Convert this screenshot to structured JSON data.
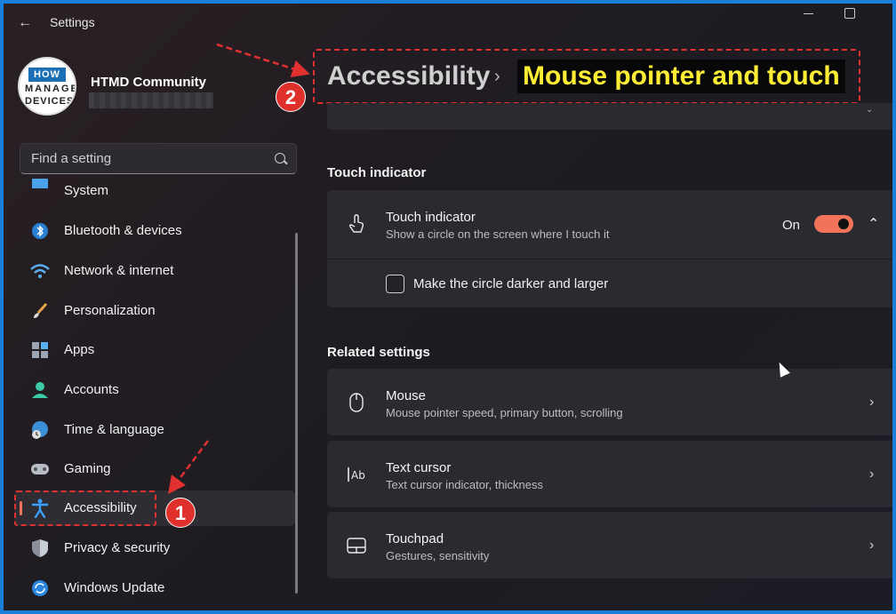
{
  "window": {
    "title": "Settings"
  },
  "profile": {
    "name": "HTMD Community",
    "logo": {
      "top": "HOW TO",
      "mid": "MANAGE",
      "bot": "DEVICES"
    }
  },
  "search": {
    "placeholder": "Find a setting"
  },
  "sidebar": {
    "items": [
      {
        "label": "System",
        "icon": "system-icon"
      },
      {
        "label": "Bluetooth & devices",
        "icon": "bluetooth-icon"
      },
      {
        "label": "Network & internet",
        "icon": "wifi-icon"
      },
      {
        "label": "Personalization",
        "icon": "brush-icon"
      },
      {
        "label": "Apps",
        "icon": "apps-icon"
      },
      {
        "label": "Accounts",
        "icon": "person-icon"
      },
      {
        "label": "Time & language",
        "icon": "globe-clock-icon"
      },
      {
        "label": "Gaming",
        "icon": "gamepad-icon"
      },
      {
        "label": "Accessibility",
        "icon": "accessibility-icon",
        "active": true
      },
      {
        "label": "Privacy & security",
        "icon": "shield-icon"
      },
      {
        "label": "Windows Update",
        "icon": "update-icon"
      }
    ]
  },
  "breadcrumb": {
    "parent": "Accessibility",
    "separator": "›",
    "current": "Mouse pointer and touch"
  },
  "touch_section": {
    "heading": "Touch indicator",
    "card": {
      "title": "Touch indicator",
      "subtitle": "Show a circle on the screen where I touch it",
      "state_label": "On",
      "enabled": true,
      "option_label": "Make the circle darker and larger",
      "option_checked": false
    }
  },
  "related": {
    "heading": "Related settings",
    "items": [
      {
        "title": "Mouse",
        "subtitle": "Mouse pointer speed, primary button, scrolling",
        "icon": "mouse-icon"
      },
      {
        "title": "Text cursor",
        "subtitle": "Text cursor indicator, thickness",
        "icon": "text-cursor-icon"
      },
      {
        "title": "Touchpad",
        "subtitle": "Gestures, sensitivity",
        "icon": "touchpad-icon"
      }
    ]
  },
  "annotations": {
    "badge1": "1",
    "badge2": "2"
  },
  "colors": {
    "accent": "#f0735a",
    "frame": "#1a7fd9",
    "highlight": "#ffee33",
    "annotation": "#e03030"
  }
}
